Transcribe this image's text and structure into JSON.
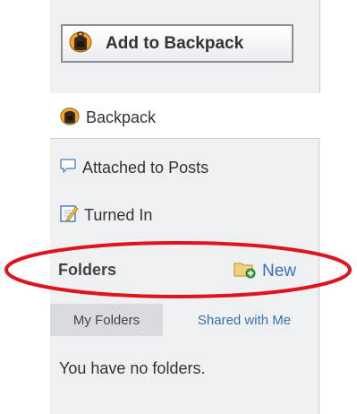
{
  "toolbar": {
    "add_button_label": "Add to Backpack"
  },
  "backpack": {
    "tab_label": "Backpack"
  },
  "nav": {
    "attached_label": "Attached to Posts",
    "turned_in_label": "Turned In"
  },
  "folders": {
    "title": "Folders",
    "new_label": "New",
    "tabs": [
      {
        "label": "My Folders",
        "selected": true
      },
      {
        "label": "Shared with Me",
        "selected": false
      }
    ],
    "empty_message": "You have no folders."
  },
  "icons": {
    "backpack": "backpack-icon",
    "speech_bubble": "speech-bubble-icon",
    "notepad": "notepad-pencil-icon",
    "new_folder": "new-folder-icon"
  },
  "colors": {
    "panel_bg": "#eef0f2",
    "link_blue": "#3b6fb6",
    "annotation_red": "#e0141e"
  }
}
